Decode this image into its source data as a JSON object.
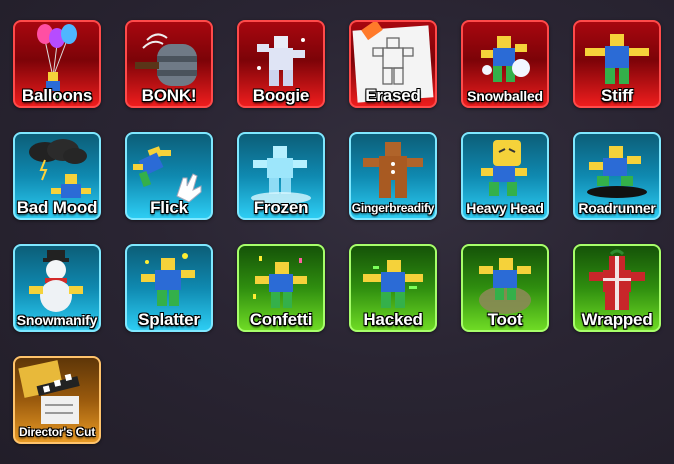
{
  "emotes": [
    {
      "label": "Balloons",
      "color": "red",
      "icon": "balloons-icon"
    },
    {
      "label": "BONK!",
      "color": "red",
      "icon": "bonk-hammer-icon"
    },
    {
      "label": "Boogie",
      "color": "red",
      "icon": "boogie-icon"
    },
    {
      "label": "Erased",
      "color": "red",
      "icon": "erased-sketch-icon"
    },
    {
      "label": "Snowballed",
      "color": "red",
      "icon": "snowballed-icon"
    },
    {
      "label": "Stiff",
      "color": "red",
      "icon": "stiff-icon"
    },
    {
      "label": "Bad Mood",
      "color": "cyan",
      "icon": "storm-cloud-icon"
    },
    {
      "label": "Flick",
      "color": "cyan",
      "icon": "flick-hand-icon"
    },
    {
      "label": "Frozen",
      "color": "cyan",
      "icon": "frozen-icon"
    },
    {
      "label": "Gingerbreadify",
      "color": "cyan",
      "icon": "gingerbread-icon"
    },
    {
      "label": "Heavy Head",
      "color": "cyan",
      "icon": "heavy-head-icon"
    },
    {
      "label": "Roadrunner",
      "color": "cyan",
      "icon": "roadrunner-icon"
    },
    {
      "label": "Snowmanify",
      "color": "cyan",
      "icon": "snowman-icon"
    },
    {
      "label": "Splatter",
      "color": "cyan",
      "icon": "splatter-icon"
    },
    {
      "label": "Confetti",
      "color": "green",
      "icon": "confetti-icon"
    },
    {
      "label": "Hacked",
      "color": "green",
      "icon": "hacked-icon"
    },
    {
      "label": "Toot",
      "color": "green",
      "icon": "toot-icon"
    },
    {
      "label": "Wrapped",
      "color": "green",
      "icon": "wrapped-icon"
    },
    {
      "label": "Director's Cut",
      "color": "orange",
      "icon": "clapperboard-icon"
    }
  ],
  "colors": {
    "red": "#ff4a4a",
    "cyan": "#7fe8ff",
    "green": "#a7ff6a",
    "orange": "#ffc36b"
  }
}
